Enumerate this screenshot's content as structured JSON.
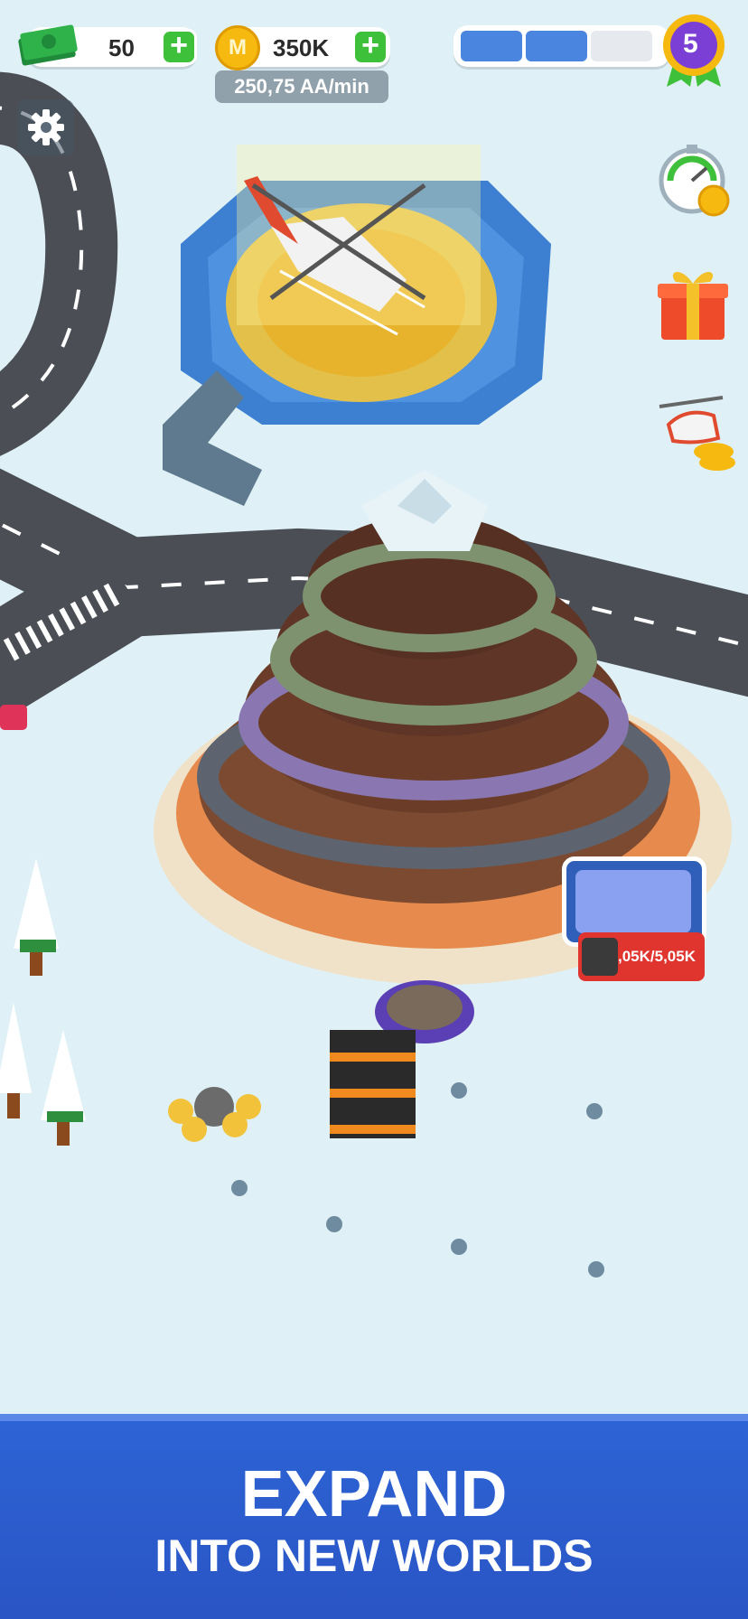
{
  "hud": {
    "cash_value": "50",
    "coin_value": "350K",
    "coin_letter": "M",
    "rate_text": "250,75 AA/min",
    "level": "5",
    "progress_fraction": 0.67
  },
  "side_icons": [
    "speed-boost-icon",
    "gift-icon",
    "helicopter-delivery-icon"
  ],
  "storage_label": "5,05K/5,05K",
  "banner": {
    "line1": "EXPAND",
    "line2": "INTO NEW WORLDS"
  },
  "colors": {
    "ground": "#dff1f7",
    "road": "#4b4f55",
    "accent_green": "#3fc03a",
    "banner_blue": "#2d64d6",
    "level_purple": "#7b3fd6"
  }
}
